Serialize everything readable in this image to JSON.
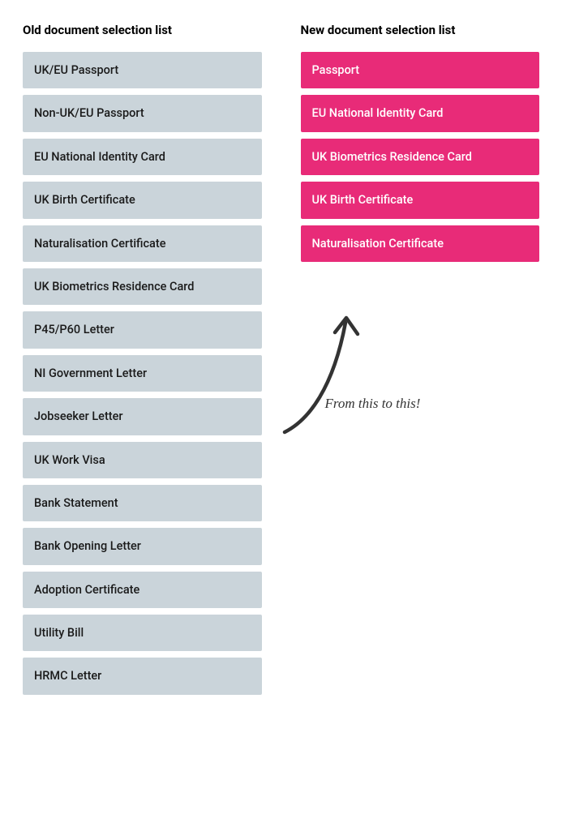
{
  "headings": {
    "old": "Old document selection list",
    "new": "New document selection list"
  },
  "old_list": [
    "UK/EU Passport",
    "Non-UK/EU Passport",
    "EU National Identity Card",
    "UK Birth Certificate",
    "Naturalisation Certificate",
    "UK Biometrics  Residence Card",
    "P45/P60 Letter",
    "NI Government Letter",
    "Jobseeker Letter",
    "UK Work Visa",
    "Bank Statement",
    "Bank Opening Letter",
    "Adoption Certificate",
    "Utility Bill",
    "HRMC Letter"
  ],
  "new_list": [
    "Passport",
    "EU National Identity Card",
    "UK Biometrics  Residence Card",
    "UK Birth Certificate",
    "Naturalisation Certificate"
  ],
  "annotation": {
    "text": "From this to this!"
  },
  "colors": {
    "old_bg": "#cad4da",
    "old_fg": "#1a1a1a",
    "new_bg": "#e82b78",
    "new_fg": "#ffffff"
  }
}
